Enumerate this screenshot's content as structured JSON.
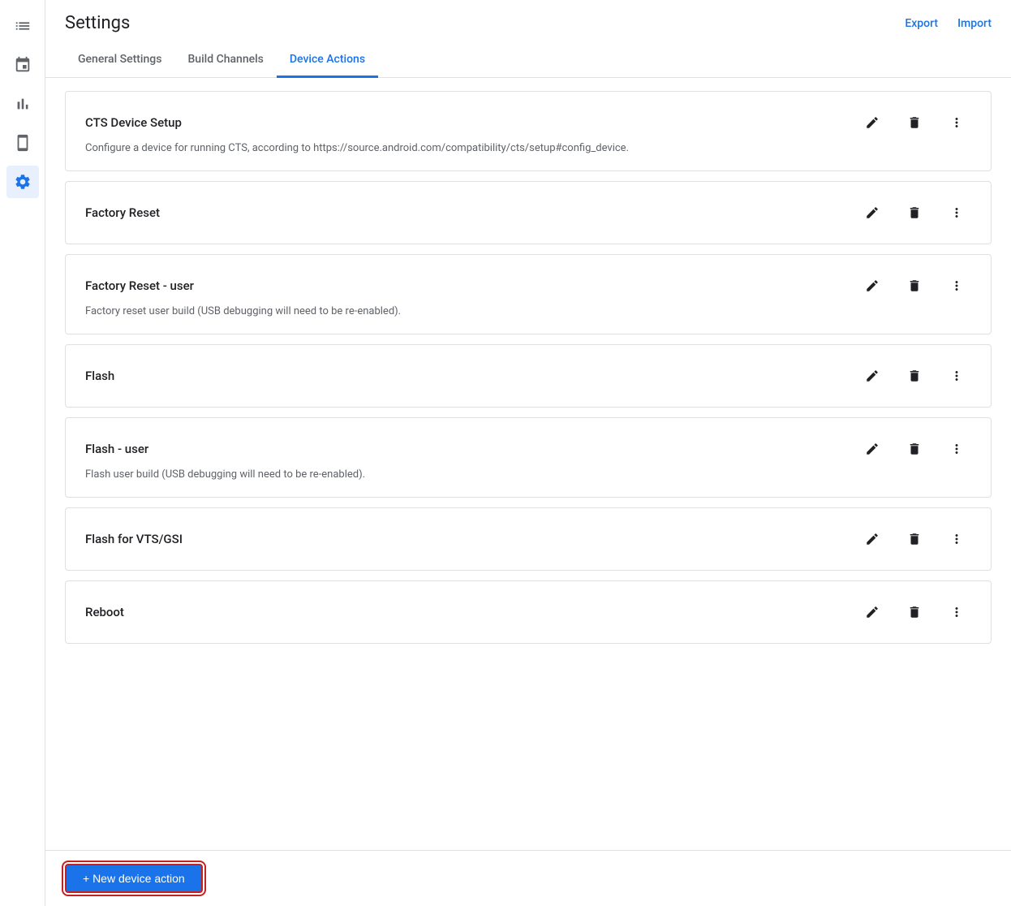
{
  "header": {
    "title": "Settings",
    "export_label": "Export",
    "import_label": "Import"
  },
  "tabs": [
    {
      "id": "general",
      "label": "General Settings",
      "active": false
    },
    {
      "id": "build-channels",
      "label": "Build Channels",
      "active": false
    },
    {
      "id": "device-actions",
      "label": "Device Actions",
      "active": true
    }
  ],
  "sidebar": {
    "items": [
      {
        "id": "list",
        "icon": "list-icon",
        "active": false
      },
      {
        "id": "calendar",
        "icon": "calendar-icon",
        "active": false
      },
      {
        "id": "chart",
        "icon": "chart-icon",
        "active": false
      },
      {
        "id": "device",
        "icon": "device-icon",
        "active": false
      },
      {
        "id": "settings",
        "icon": "settings-icon",
        "active": true
      }
    ]
  },
  "actions": [
    {
      "id": "cts-device-setup",
      "title": "CTS Device Setup",
      "description": "Configure a device for running CTS, according to https://source.android.com/compatibility/cts/setup#config_device."
    },
    {
      "id": "factory-reset",
      "title": "Factory Reset",
      "description": ""
    },
    {
      "id": "factory-reset-user",
      "title": "Factory Reset - user",
      "description": "Factory reset user build (USB debugging will need to be re-enabled)."
    },
    {
      "id": "flash",
      "title": "Flash",
      "description": ""
    },
    {
      "id": "flash-user",
      "title": "Flash - user",
      "description": "Flash user build (USB debugging will need to be re-enabled)."
    },
    {
      "id": "flash-vts-gsi",
      "title": "Flash for VTS/GSI",
      "description": ""
    },
    {
      "id": "reboot",
      "title": "Reboot",
      "description": ""
    }
  ],
  "footer": {
    "new_action_label": "+ New device action"
  }
}
